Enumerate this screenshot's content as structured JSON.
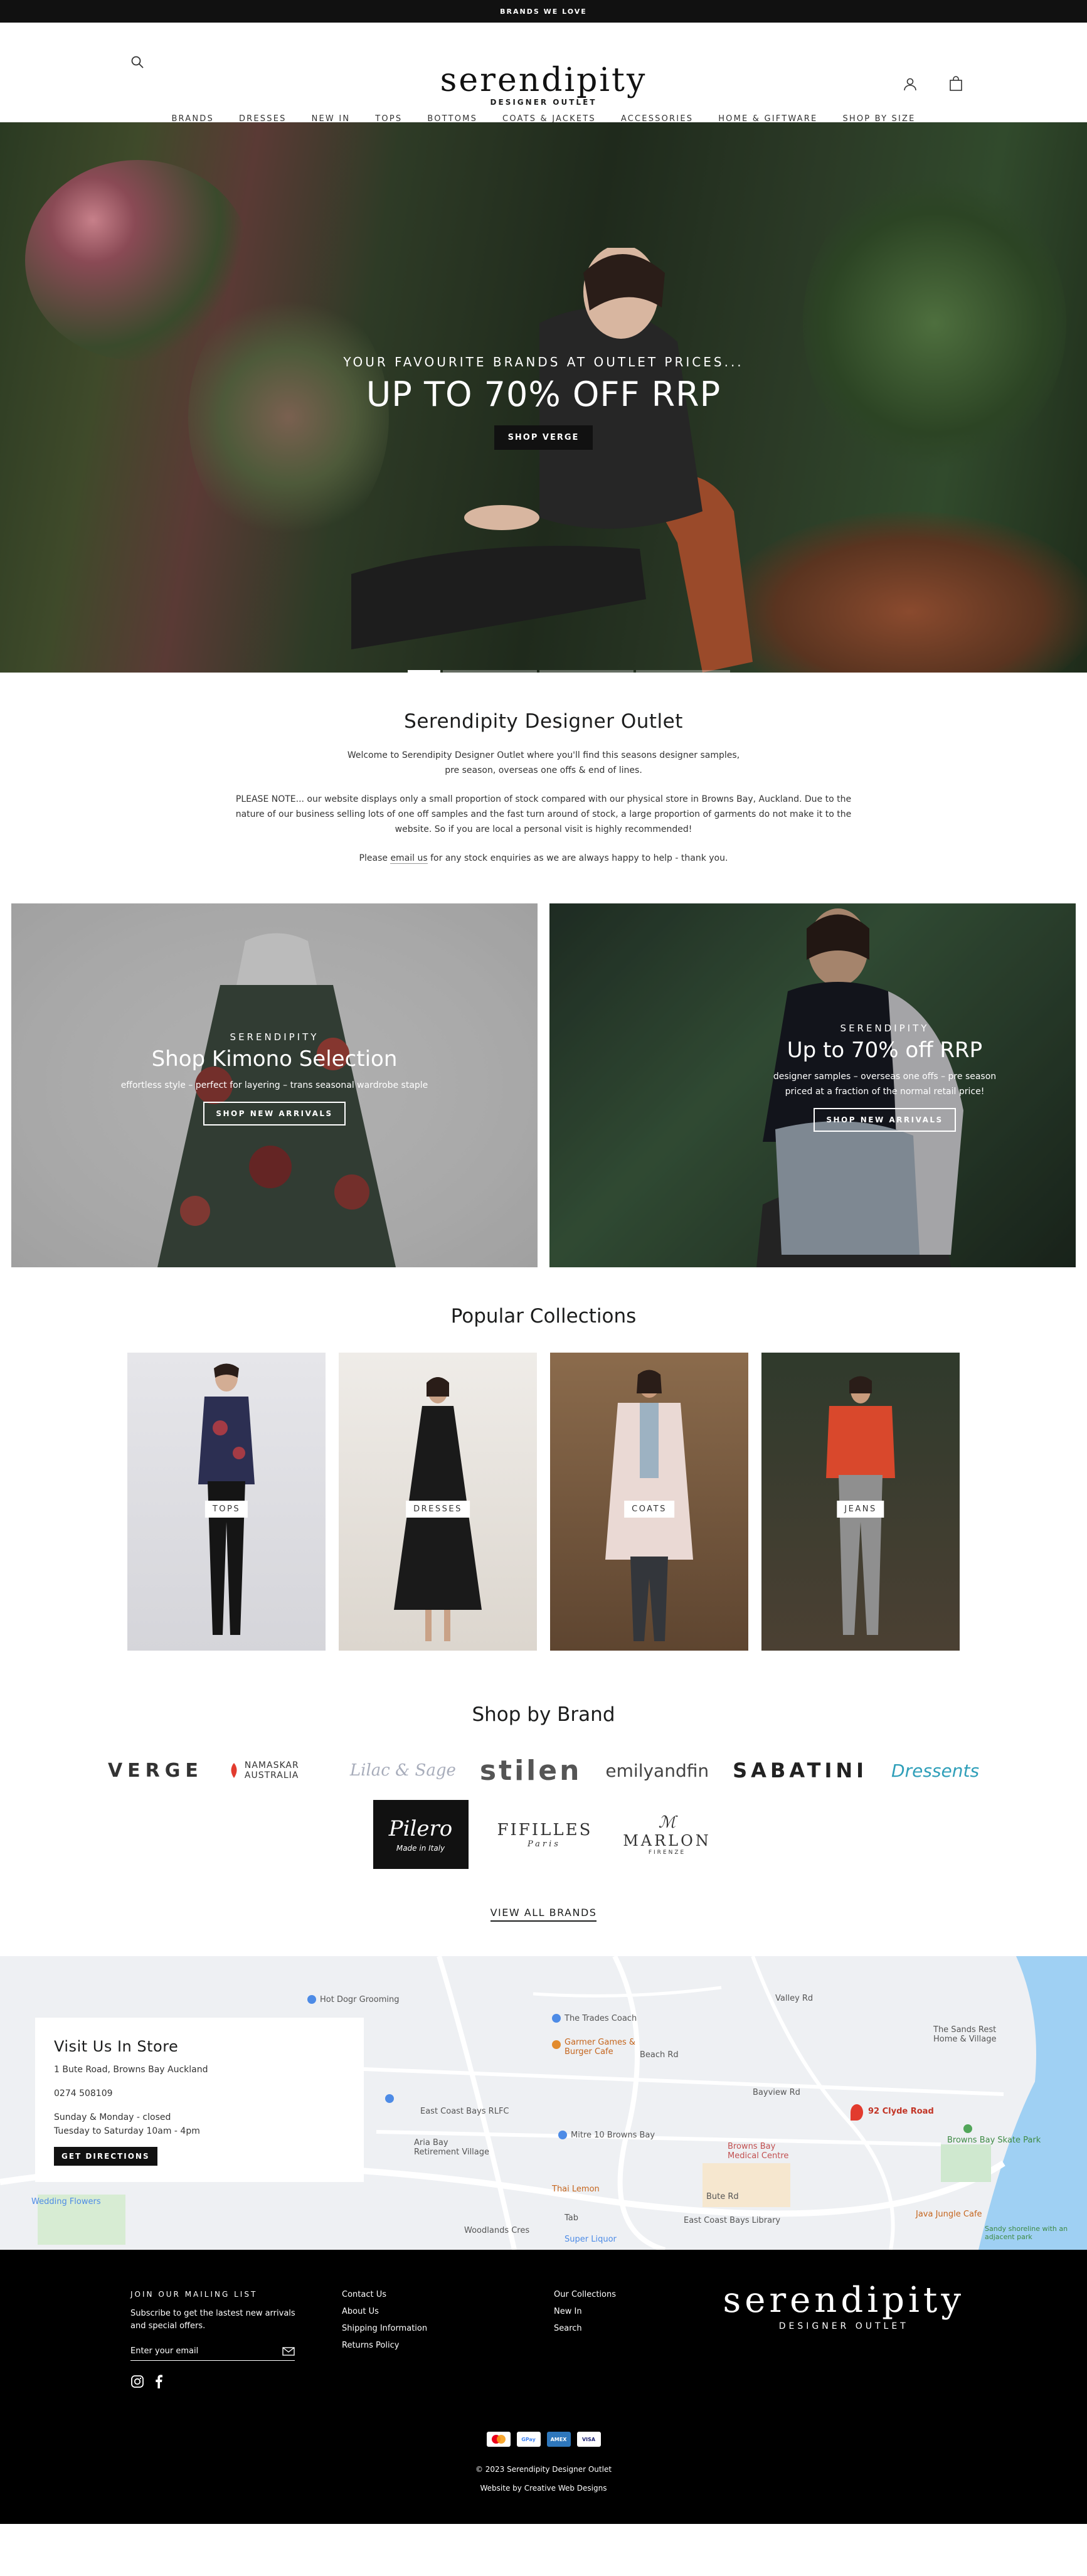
{
  "announcement": "BRANDS WE LOVE",
  "header": {
    "logo_main": "serendipity",
    "logo_sub": "DESIGNER OUTLET",
    "nav": [
      "BRANDS",
      "DRESSES",
      "NEW IN",
      "TOPS",
      "BOTTOMS",
      "COATS & JACKETS",
      "ACCESSORIES",
      "HOME & GIFTWARE",
      "SHOP BY SIZE"
    ]
  },
  "hero": {
    "subtitle": "YOUR FAVOURITE BRANDS AT OUTLET PRICES...",
    "title": "UP TO 70% OFF RRP",
    "button": "SHOP VERGE",
    "slides": 4,
    "active_slide": 1
  },
  "intro": {
    "title": "Serendipity Designer Outlet",
    "p1": "Welcome to Serendipity Designer Outlet where you'll find this seasons designer samples, pre season, overseas one offs & end of lines.",
    "p2": "PLEASE NOTE... our website displays only a small proportion of stock compared with our physical store in Browns Bay, Auckland. Due to the nature of our business selling lots of one off samples and the fast turn around of stock, a large proportion of garments do not make it to the website. So if you are local a personal visit is highly recommended!",
    "p3_before": "Please ",
    "p3_link": "email us",
    "p3_after": " for any stock enquiries as we are always happy to help - thank you."
  },
  "promos": [
    {
      "eyebrow": "SERENDIPITY",
      "title": "Shop Kimono Selection",
      "text": "effortless style – perfect for layering – trans seasonal wardrobe staple",
      "button": "SHOP NEW ARRIVALS"
    },
    {
      "eyebrow": "SERENDIPITY",
      "title": "Up to 70% off RRP",
      "text": "designer samples – overseas one offs – pre season priced at a fraction of the normal retail price!",
      "button": "SHOP NEW ARRIVALS"
    }
  ],
  "collections": {
    "title": "Popular Collections",
    "items": [
      "TOPS",
      "DRESSES",
      "COATS",
      "JEANS"
    ]
  },
  "brands": {
    "title": "Shop by Brand",
    "row1": [
      "VERGE",
      "NAMASKAR AUSTRALIA",
      "Lilac & Sage",
      "stilen",
      "emilyandfin",
      "SABATINI",
      "Dressents"
    ],
    "pilero": "Pilero",
    "pilero_sub": "Made in Italy",
    "fifilles": "FIFILLES",
    "fifilles_sub": "Paris",
    "marlon": "MARLON",
    "marlon_sub": "FIRENZE",
    "view_all": "VIEW ALL BRANDS"
  },
  "map": {
    "title": "Visit Us In Store",
    "address": "1 Bute Road, Browns Bay Auckland",
    "phone": "0274 508109",
    "hours1": "Sunday & Monday - closed",
    "hours2": "Tuesday to Saturday 10am - 4pm",
    "button": "GET DIRECTIONS",
    "labels": {
      "hotdog": "Hot Dogr Grooming",
      "trades": "The Trades Coach",
      "garmer": "Garmer Games & Burger Cafe",
      "sands": "The Sands Rest Home & Village",
      "clyde": "92 Clyde Road",
      "skate": "Browns Bay Skate Park",
      "eastcoast": "East Coast Bays RLFC",
      "aria": "Aria Bay Retirement Village",
      "mitre": "Mitre 10 Browns Bay",
      "medical": "Browns Bay Medical Centre",
      "lemon": "Thai Lemon",
      "library": "East Coast Bays Library",
      "java": "Java Jungle Cafe",
      "beach": "Sandy shoreline with an adjacent park",
      "liquor": "Super Liquor",
      "wedding": "Wedding Flowers",
      "tab": "Tab",
      "bute": "Bute Rd",
      "beachrd": "Beach Rd",
      "valley": "Valley Rd",
      "woodlands": "Woodlands Cres",
      "bayview": "Bayview Rd"
    }
  },
  "footer": {
    "mailing_heading": "JOIN OUR MAILING LIST",
    "mailing_text": "Subscribe to get the lastest new arrivals and special offers.",
    "email_placeholder": "Enter your email",
    "links1": [
      "Contact Us",
      "About Us",
      "Shipping Information",
      "Returns Policy"
    ],
    "links2": [
      "Our Collections",
      "New In",
      "Search"
    ],
    "logo_main": "serendipity",
    "logo_sub": "DESIGNER OUTLET",
    "payments": [
      "MC",
      "GPay",
      "AMEX",
      "VISA"
    ],
    "copyright": "© 2023 Serendipity Designer Outlet",
    "credit": "Website by Creative Web Designs"
  },
  "colors": {
    "black": "#111111",
    "text": "#1c1d1d",
    "accent_red": "#e23b2e"
  }
}
